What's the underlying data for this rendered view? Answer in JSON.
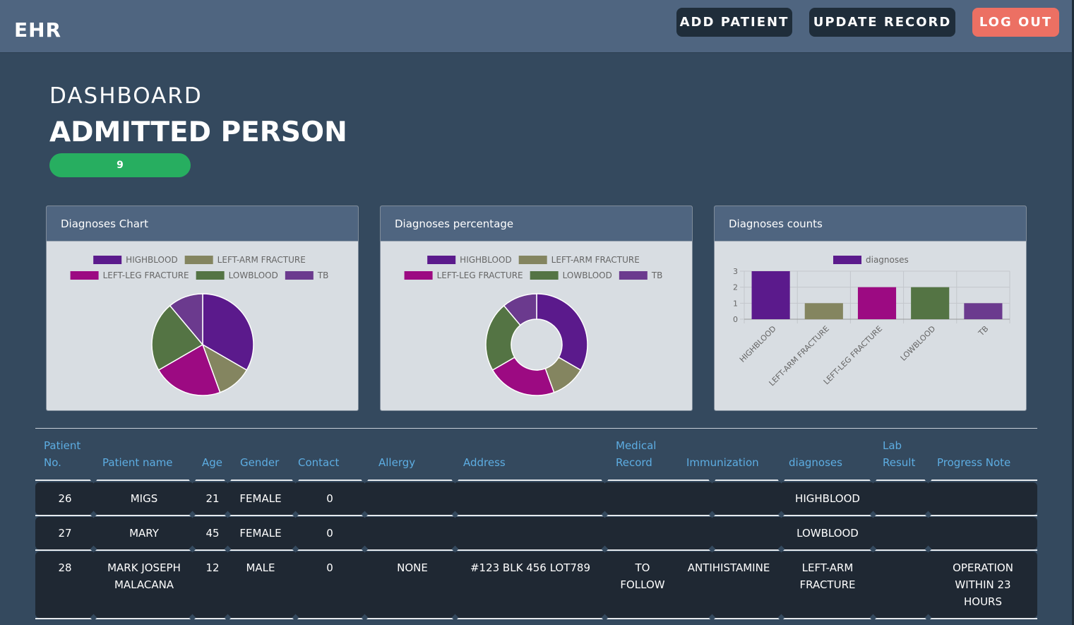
{
  "header": {
    "brand": "EHR",
    "add_patient": "ADD PATIENT",
    "update_record": "UPDATE RECORD",
    "log_out": "LOG OUT"
  },
  "dashboard": {
    "title": "DASHBOARD",
    "subtitle": "ADMITTED PERSON",
    "admitted_count": "9"
  },
  "cards": {
    "chart1_title": "Diagnoses Chart",
    "chart2_title": "Diagnoses percentage",
    "chart3_title": "Diagnoses counts"
  },
  "chart_data": [
    {
      "type": "pie",
      "title": "",
      "labels": [
        "HIGHBLOOD",
        "LEFT-ARM FRACTURE",
        "LEFT-LEG FRACTURE",
        "LOWBLOOD",
        "TB"
      ],
      "values": [
        3,
        1,
        2,
        2,
        1
      ],
      "colors": [
        "#5b1a8c",
        "#848560",
        "#9c0a82",
        "#547444",
        "#6b3a8e"
      ],
      "legend": "top"
    },
    {
      "type": "pie",
      "variant": "doughnut",
      "title": "",
      "labels": [
        "HIGHBLOOD",
        "LEFT-ARM FRACTURE",
        "LEFT-LEG FRACTURE",
        "LOWBLOOD",
        "TB"
      ],
      "values": [
        3,
        1,
        2,
        2,
        1
      ],
      "colors": [
        "#5b1a8c",
        "#848560",
        "#9c0a82",
        "#547444",
        "#6b3a8e"
      ],
      "legend": "top"
    },
    {
      "type": "bar",
      "title": "",
      "categories": [
        "HIGHBLOOD",
        "LEFT-ARM FRACTURE",
        "LEFT-LEG FRACTURE",
        "LOWBLOOD",
        "TB"
      ],
      "series": [
        {
          "name": "diagnoses",
          "values": [
            3,
            1,
            2,
            2,
            1
          ]
        }
      ],
      "colors": [
        "#5b1a8c",
        "#848560",
        "#9c0a82",
        "#547444",
        "#6b3a8e"
      ],
      "ylim": [
        0,
        3
      ],
      "yticks": [
        "0",
        "1",
        "2",
        "3"
      ],
      "grid": true,
      "legend": "top"
    }
  ],
  "table": {
    "headers": {
      "patient_no": [
        "Patient",
        "No."
      ],
      "patient_name": "Patient name",
      "age": "Age",
      "gender": "Gender",
      "contact": "Contact",
      "allergy": "Allergy",
      "address": "Address",
      "medical_record": [
        "Medical",
        "Record"
      ],
      "immunization": "Immunization",
      "diagnoses": "diagnoses",
      "lab_result": [
        "Lab",
        "Result"
      ],
      "progress_note": "Progress Note"
    },
    "rows": [
      {
        "no": "26",
        "name": [
          "MIGS"
        ],
        "age": "21",
        "gender": "FEMALE",
        "contact": "0",
        "allergy": "",
        "address": "",
        "medical_record": [],
        "immunization": "",
        "diagnoses": [
          "HIGHBLOOD"
        ],
        "lab_result": "",
        "progress_note": []
      },
      {
        "no": "27",
        "name": [
          "MARY"
        ],
        "age": "45",
        "gender": "FEMALE",
        "contact": "0",
        "allergy": "",
        "address": "",
        "medical_record": [],
        "immunization": "",
        "diagnoses": [
          "LOWBLOOD"
        ],
        "lab_result": "",
        "progress_note": []
      },
      {
        "no": "28",
        "name": [
          "MARK JOSEPH",
          "MALACANA"
        ],
        "age": "12",
        "gender": "MALE",
        "contact": "0",
        "allergy": "NONE",
        "address": "#123 BLK 456 LOT789",
        "medical_record": [
          "TO",
          "FOLLOW"
        ],
        "immunization": "ANTIHISTAMINE",
        "diagnoses": [
          "LEFT-ARM",
          "FRACTURE"
        ],
        "lab_result": "",
        "progress_note": [
          "OPERATION",
          "WITHIN 23",
          "HOURS"
        ]
      }
    ]
  }
}
